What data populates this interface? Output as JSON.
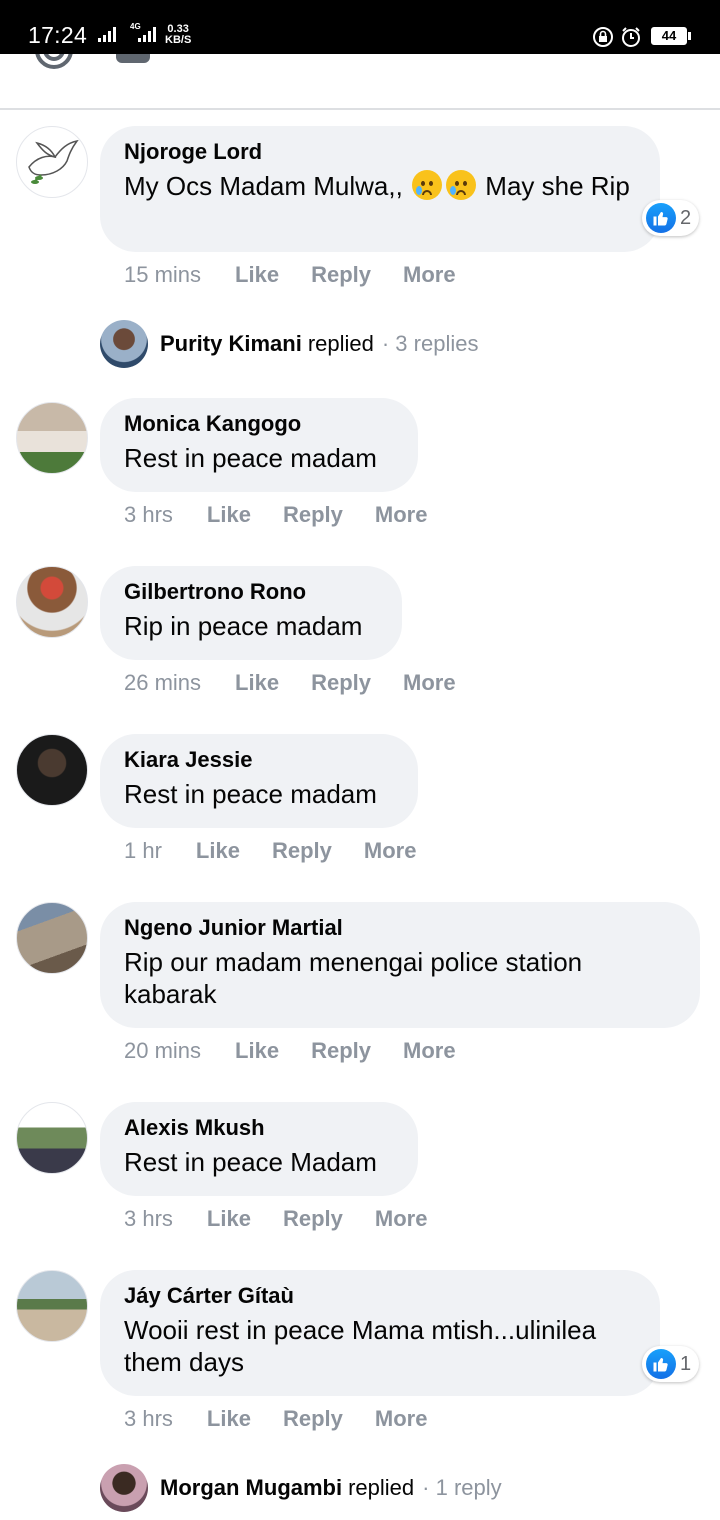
{
  "status_bar": {
    "time": "17:24",
    "network": "4G",
    "speed_value": "0.33",
    "speed_unit": "KB/S",
    "battery": "44"
  },
  "comments": [
    {
      "author": "Njoroge Lord",
      "text": "My Ocs Madam Mulwa,, ",
      "text_after_emoji": " May she Rip",
      "emoji": [
        "sad-tear-emoji",
        "sad-tear-emoji"
      ],
      "time": "15 mins",
      "like": "Like",
      "reply": "Reply",
      "more": "More",
      "reaction_count": "2",
      "replies": {
        "name": "Purity Kimani",
        "verb": "replied",
        "count": "· 3 replies"
      }
    },
    {
      "author": "Monica Kangogo",
      "text": "Rest in peace madam",
      "time": "3 hrs",
      "like": "Like",
      "reply": "Reply",
      "more": "More"
    },
    {
      "author": "Gilbertrono Rono",
      "text": "Rip in peace madam",
      "time": "26 mins",
      "like": "Like",
      "reply": "Reply",
      "more": "More"
    },
    {
      "author": "Kiara Jessie",
      "text": "Rest in peace madam",
      "time": "1 hr",
      "like": "Like",
      "reply": "Reply",
      "more": "More"
    },
    {
      "author": "Ngeno Junior Martial",
      "text": "Rip our madam menengai police station kabarak",
      "time": "20 mins",
      "like": "Like",
      "reply": "Reply",
      "more": "More"
    },
    {
      "author": "Alexis Mkush",
      "text": "Rest in peace Madam",
      "time": "3 hrs",
      "like": "Like",
      "reply": "Reply",
      "more": "More"
    },
    {
      "author": "Jáy Cárter Gítaù",
      "text": "Wooii rest in peace Mama mtish...ulinilea them days",
      "time": "3 hrs",
      "like": "Like",
      "reply": "Reply",
      "more": "More",
      "reaction_count": "1",
      "replies": {
        "name": "Morgan Mugambi",
        "verb": "replied",
        "count": "· 1 reply"
      }
    }
  ]
}
